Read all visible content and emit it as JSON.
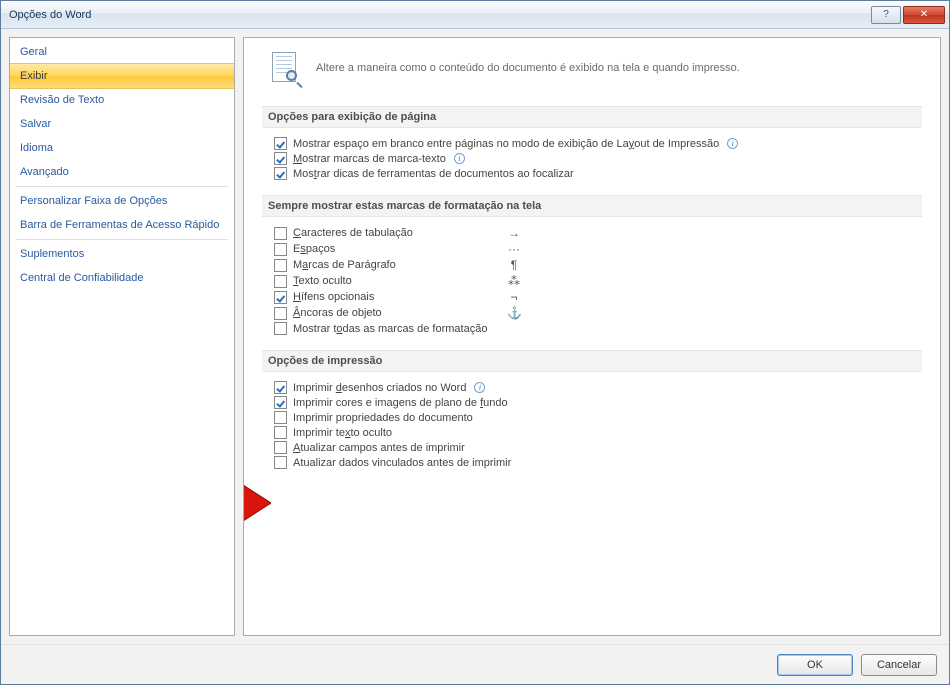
{
  "window": {
    "title": "Opções do Word"
  },
  "win_buttons": {
    "help": "?",
    "close": "✕"
  },
  "sidebar": {
    "items": [
      {
        "label": "Geral"
      },
      {
        "label": "Exibir"
      },
      {
        "label": "Revisão de Texto"
      },
      {
        "label": "Salvar"
      },
      {
        "label": "Idioma"
      },
      {
        "label": "Avançado"
      },
      {
        "label": "Personalizar Faixa de Opções"
      },
      {
        "label": "Barra de Ferramentas de Acesso Rápido"
      },
      {
        "label": "Suplementos"
      },
      {
        "label": "Central de Confiabilidade"
      }
    ],
    "selected_index": 1
  },
  "header": {
    "text": "Altere a maneira como o conteúdo do documento é exibido na tela e quando impresso."
  },
  "sections": {
    "page_display": {
      "title": "Opções para exibição de página",
      "items": [
        {
          "label_parts": [
            "Mostrar espaço em branco entre páginas no modo de exibição de La",
            "y",
            "out de Impressão"
          ],
          "checked": true,
          "info": true
        },
        {
          "label_parts": [
            "",
            "M",
            "ostrar marcas de marca-texto"
          ],
          "checked": true,
          "info": true
        },
        {
          "label_parts": [
            "Mos",
            "t",
            "rar dicas de ferramentas de documentos ao focalizar"
          ],
          "checked": true,
          "info": false
        }
      ]
    },
    "formatting": {
      "title": "Sempre mostrar estas marcas de formatação na tela",
      "items": [
        {
          "label_parts": [
            "",
            "C",
            "aracteres de tabulação"
          ],
          "checked": false,
          "symbol": "→"
        },
        {
          "label_parts": [
            "E",
            "s",
            "paços"
          ],
          "checked": false,
          "symbol": "···"
        },
        {
          "label_parts": [
            "M",
            "a",
            "rcas de Parágrafo"
          ],
          "checked": false,
          "symbol": "¶"
        },
        {
          "label_parts": [
            "",
            "T",
            "exto oculto"
          ],
          "checked": false,
          "symbol": "⁂"
        },
        {
          "label_parts": [
            "",
            "H",
            "ífens opcionais"
          ],
          "checked": true,
          "symbol": "¬"
        },
        {
          "label_parts": [
            "",
            "Â",
            "ncoras de objeto"
          ],
          "checked": false,
          "symbol": "⚓"
        },
        {
          "label_parts": [
            "Mostrar t",
            "o",
            "das as marcas de formatação"
          ],
          "checked": false,
          "symbol": ""
        }
      ]
    },
    "printing": {
      "title": "Opções de impressão",
      "items": [
        {
          "label_parts": [
            "Imprimir ",
            "d",
            "esenhos criados no Word"
          ],
          "checked": true,
          "info": true
        },
        {
          "label_parts": [
            "Imprimir cores e imagens de plano de ",
            "f",
            "undo"
          ],
          "checked": true,
          "info": false
        },
        {
          "label_parts": [
            "Imprimir propriedades do documento",
            "",
            ""
          ],
          "checked": false,
          "info": false
        },
        {
          "label_parts": [
            "Imprimir te",
            "x",
            "to oculto"
          ],
          "checked": false,
          "info": false
        },
        {
          "label_parts": [
            "",
            "A",
            "tualizar campos antes de imprimir"
          ],
          "checked": false,
          "info": false
        },
        {
          "label_parts": [
            "Atualizar dados vinculados antes de imprimir",
            "",
            ""
          ],
          "checked": false,
          "info": false
        }
      ]
    }
  },
  "footer": {
    "ok": "OK",
    "cancel": "Cancelar"
  }
}
